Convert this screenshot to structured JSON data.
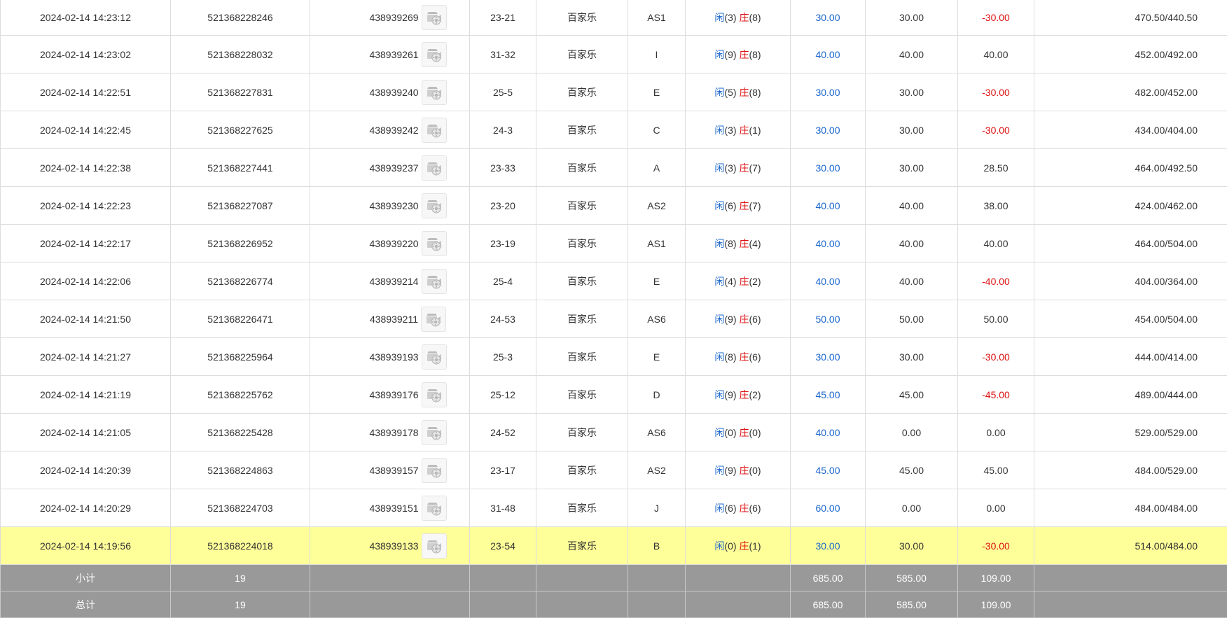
{
  "colors": {
    "player": "#1a66cc",
    "banker": "#dd1111",
    "negative": "#dd1111",
    "highlight_row": "#ffff99",
    "summary_bg": "#999999"
  },
  "labels": {
    "player": "闲",
    "banker": "庄"
  },
  "icon": "video-replay-icon",
  "rows": [
    {
      "time": "2024-02-14 14:23:12",
      "bet_id": "521368228246",
      "round_no": "438939269",
      "shoe": "23-21",
      "game": "百家乐",
      "table": "AS1",
      "p": "3",
      "b": "8",
      "bet": "30.00",
      "valid": "30.00",
      "win": "-30.00",
      "win_neg": true,
      "balance": "470.50/440.50",
      "highlight": false
    },
    {
      "time": "2024-02-14 14:23:02",
      "bet_id": "521368228032",
      "round_no": "438939261",
      "shoe": "31-32",
      "game": "百家乐",
      "table": "I",
      "p": "9",
      "b": "8",
      "bet": "40.00",
      "valid": "40.00",
      "win": "40.00",
      "win_neg": false,
      "balance": "452.00/492.00",
      "highlight": false
    },
    {
      "time": "2024-02-14 14:22:51",
      "bet_id": "521368227831",
      "round_no": "438939240",
      "shoe": "25-5",
      "game": "百家乐",
      "table": "E",
      "p": "5",
      "b": "8",
      "bet": "30.00",
      "valid": "30.00",
      "win": "-30.00",
      "win_neg": true,
      "balance": "482.00/452.00",
      "highlight": false
    },
    {
      "time": "2024-02-14 14:22:45",
      "bet_id": "521368227625",
      "round_no": "438939242",
      "shoe": "24-3",
      "game": "百家乐",
      "table": "C",
      "p": "3",
      "b": "1",
      "bet": "30.00",
      "valid": "30.00",
      "win": "-30.00",
      "win_neg": true,
      "balance": "434.00/404.00",
      "highlight": false
    },
    {
      "time": "2024-02-14 14:22:38",
      "bet_id": "521368227441",
      "round_no": "438939237",
      "shoe": "23-33",
      "game": "百家乐",
      "table": "A",
      "p": "3",
      "b": "7",
      "bet": "30.00",
      "valid": "30.00",
      "win": "28.50",
      "win_neg": false,
      "balance": "464.00/492.50",
      "highlight": false
    },
    {
      "time": "2024-02-14 14:22:23",
      "bet_id": "521368227087",
      "round_no": "438939230",
      "shoe": "23-20",
      "game": "百家乐",
      "table": "AS2",
      "p": "6",
      "b": "7",
      "bet": "40.00",
      "valid": "40.00",
      "win": "38.00",
      "win_neg": false,
      "balance": "424.00/462.00",
      "highlight": false
    },
    {
      "time": "2024-02-14 14:22:17",
      "bet_id": "521368226952",
      "round_no": "438939220",
      "shoe": "23-19",
      "game": "百家乐",
      "table": "AS1",
      "p": "8",
      "b": "4",
      "bet": "40.00",
      "valid": "40.00",
      "win": "40.00",
      "win_neg": false,
      "balance": "464.00/504.00",
      "highlight": false
    },
    {
      "time": "2024-02-14 14:22:06",
      "bet_id": "521368226774",
      "round_no": "438939214",
      "shoe": "25-4",
      "game": "百家乐",
      "table": "E",
      "p": "4",
      "b": "2",
      "bet": "40.00",
      "valid": "40.00",
      "win": "-40.00",
      "win_neg": true,
      "balance": "404.00/364.00",
      "highlight": false
    },
    {
      "time": "2024-02-14 14:21:50",
      "bet_id": "521368226471",
      "round_no": "438939211",
      "shoe": "24-53",
      "game": "百家乐",
      "table": "AS6",
      "p": "9",
      "b": "6",
      "bet": "50.00",
      "valid": "50.00",
      "win": "50.00",
      "win_neg": false,
      "balance": "454.00/504.00",
      "highlight": false
    },
    {
      "time": "2024-02-14 14:21:27",
      "bet_id": "521368225964",
      "round_no": "438939193",
      "shoe": "25-3",
      "game": "百家乐",
      "table": "E",
      "p": "8",
      "b": "6",
      "bet": "30.00",
      "valid": "30.00",
      "win": "-30.00",
      "win_neg": true,
      "balance": "444.00/414.00",
      "highlight": false
    },
    {
      "time": "2024-02-14 14:21:19",
      "bet_id": "521368225762",
      "round_no": "438939176",
      "shoe": "25-12",
      "game": "百家乐",
      "table": "D",
      "p": "9",
      "b": "2",
      "bet": "45.00",
      "valid": "45.00",
      "win": "-45.00",
      "win_neg": true,
      "balance": "489.00/444.00",
      "highlight": false
    },
    {
      "time": "2024-02-14 14:21:05",
      "bet_id": "521368225428",
      "round_no": "438939178",
      "shoe": "24-52",
      "game": "百家乐",
      "table": "AS6",
      "p": "0",
      "b": "0",
      "bet": "40.00",
      "valid": "0.00",
      "win": "0.00",
      "win_neg": false,
      "balance": "529.00/529.00",
      "highlight": false
    },
    {
      "time": "2024-02-14 14:20:39",
      "bet_id": "521368224863",
      "round_no": "438939157",
      "shoe": "23-17",
      "game": "百家乐",
      "table": "AS2",
      "p": "9",
      "b": "0",
      "bet": "45.00",
      "valid": "45.00",
      "win": "45.00",
      "win_neg": false,
      "balance": "484.00/529.00",
      "highlight": false
    },
    {
      "time": "2024-02-14 14:20:29",
      "bet_id": "521368224703",
      "round_no": "438939151",
      "shoe": "31-48",
      "game": "百家乐",
      "table": "J",
      "p": "6",
      "b": "6",
      "bet": "60.00",
      "valid": "0.00",
      "win": "0.00",
      "win_neg": false,
      "balance": "484.00/484.00",
      "highlight": false
    },
    {
      "time": "2024-02-14 14:19:56",
      "bet_id": "521368224018",
      "round_no": "438939133",
      "shoe": "23-54",
      "game": "百家乐",
      "table": "B",
      "p": "0",
      "b": "1",
      "bet": "30.00",
      "valid": "30.00",
      "win": "-30.00",
      "win_neg": true,
      "balance": "514.00/484.00",
      "highlight": true
    }
  ],
  "summary": [
    {
      "label": "小计",
      "count": "19",
      "bet": "685.00",
      "valid": "585.00",
      "win": "109.00"
    },
    {
      "label": "总计",
      "count": "19",
      "bet": "685.00",
      "valid": "585.00",
      "win": "109.00"
    }
  ]
}
